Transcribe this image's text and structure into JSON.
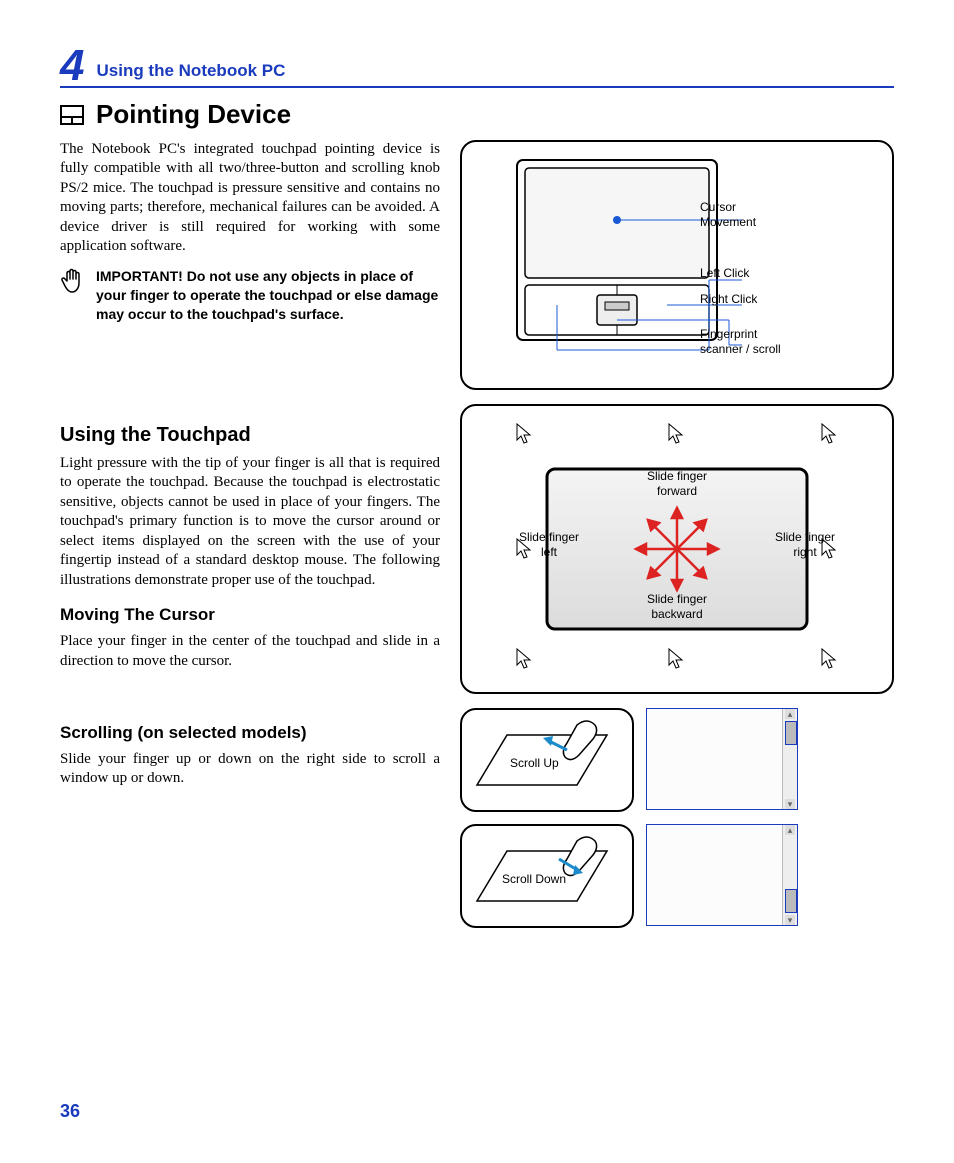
{
  "chapter": {
    "num": "4",
    "title": "Using the Notebook PC"
  },
  "section": {
    "title": "Pointing Device",
    "intro": "The Notebook PC's integrated touchpad pointing device is fully compatible with all two/three-button and scrolling knob PS/2 mice. The touchpad is pressure sensitive and contains no moving parts; therefore, mechanical failures can be avoided. A device driver is still required for working with some application software."
  },
  "important": "IMPORTANT! Do not use any objects in place of your finger to operate the touchpad or else damage may occur to the touchpad's surface.",
  "using": {
    "title": "Using the Touchpad",
    "body": "Light pressure with the tip of your finger is all that is required to operate the touchpad. Because the touchpad is electrostatic sensitive, objects cannot be used in place of your fingers. The touchpad's primary function is to move the cursor around or select items displayed on the screen with the use of your fingertip instead of a standard desktop mouse. The following illustrations demonstrate proper use of the touchpad."
  },
  "moving": {
    "title": "Moving The Cursor",
    "body": "Place your finger in the center of the touchpad and slide in a direction to move the cursor."
  },
  "scrolling": {
    "title": "Scrolling (on selected models)",
    "body": "Slide your finger up or down on the right side to scroll a window up or down."
  },
  "labels": {
    "cursor_movement": "Cursor Movement",
    "left_click": "Left Click",
    "right_click": "Right Click",
    "fingerprint": "Fingerprint scanner / scroll",
    "slide_forward": "Slide finger forward",
    "slide_backward": "Slide finger backward",
    "slide_left": "Slide finger left",
    "slide_right": "Slide finger right",
    "scroll_up": "Scroll Up",
    "scroll_down": "Scroll Down"
  },
  "pagenum": "36"
}
